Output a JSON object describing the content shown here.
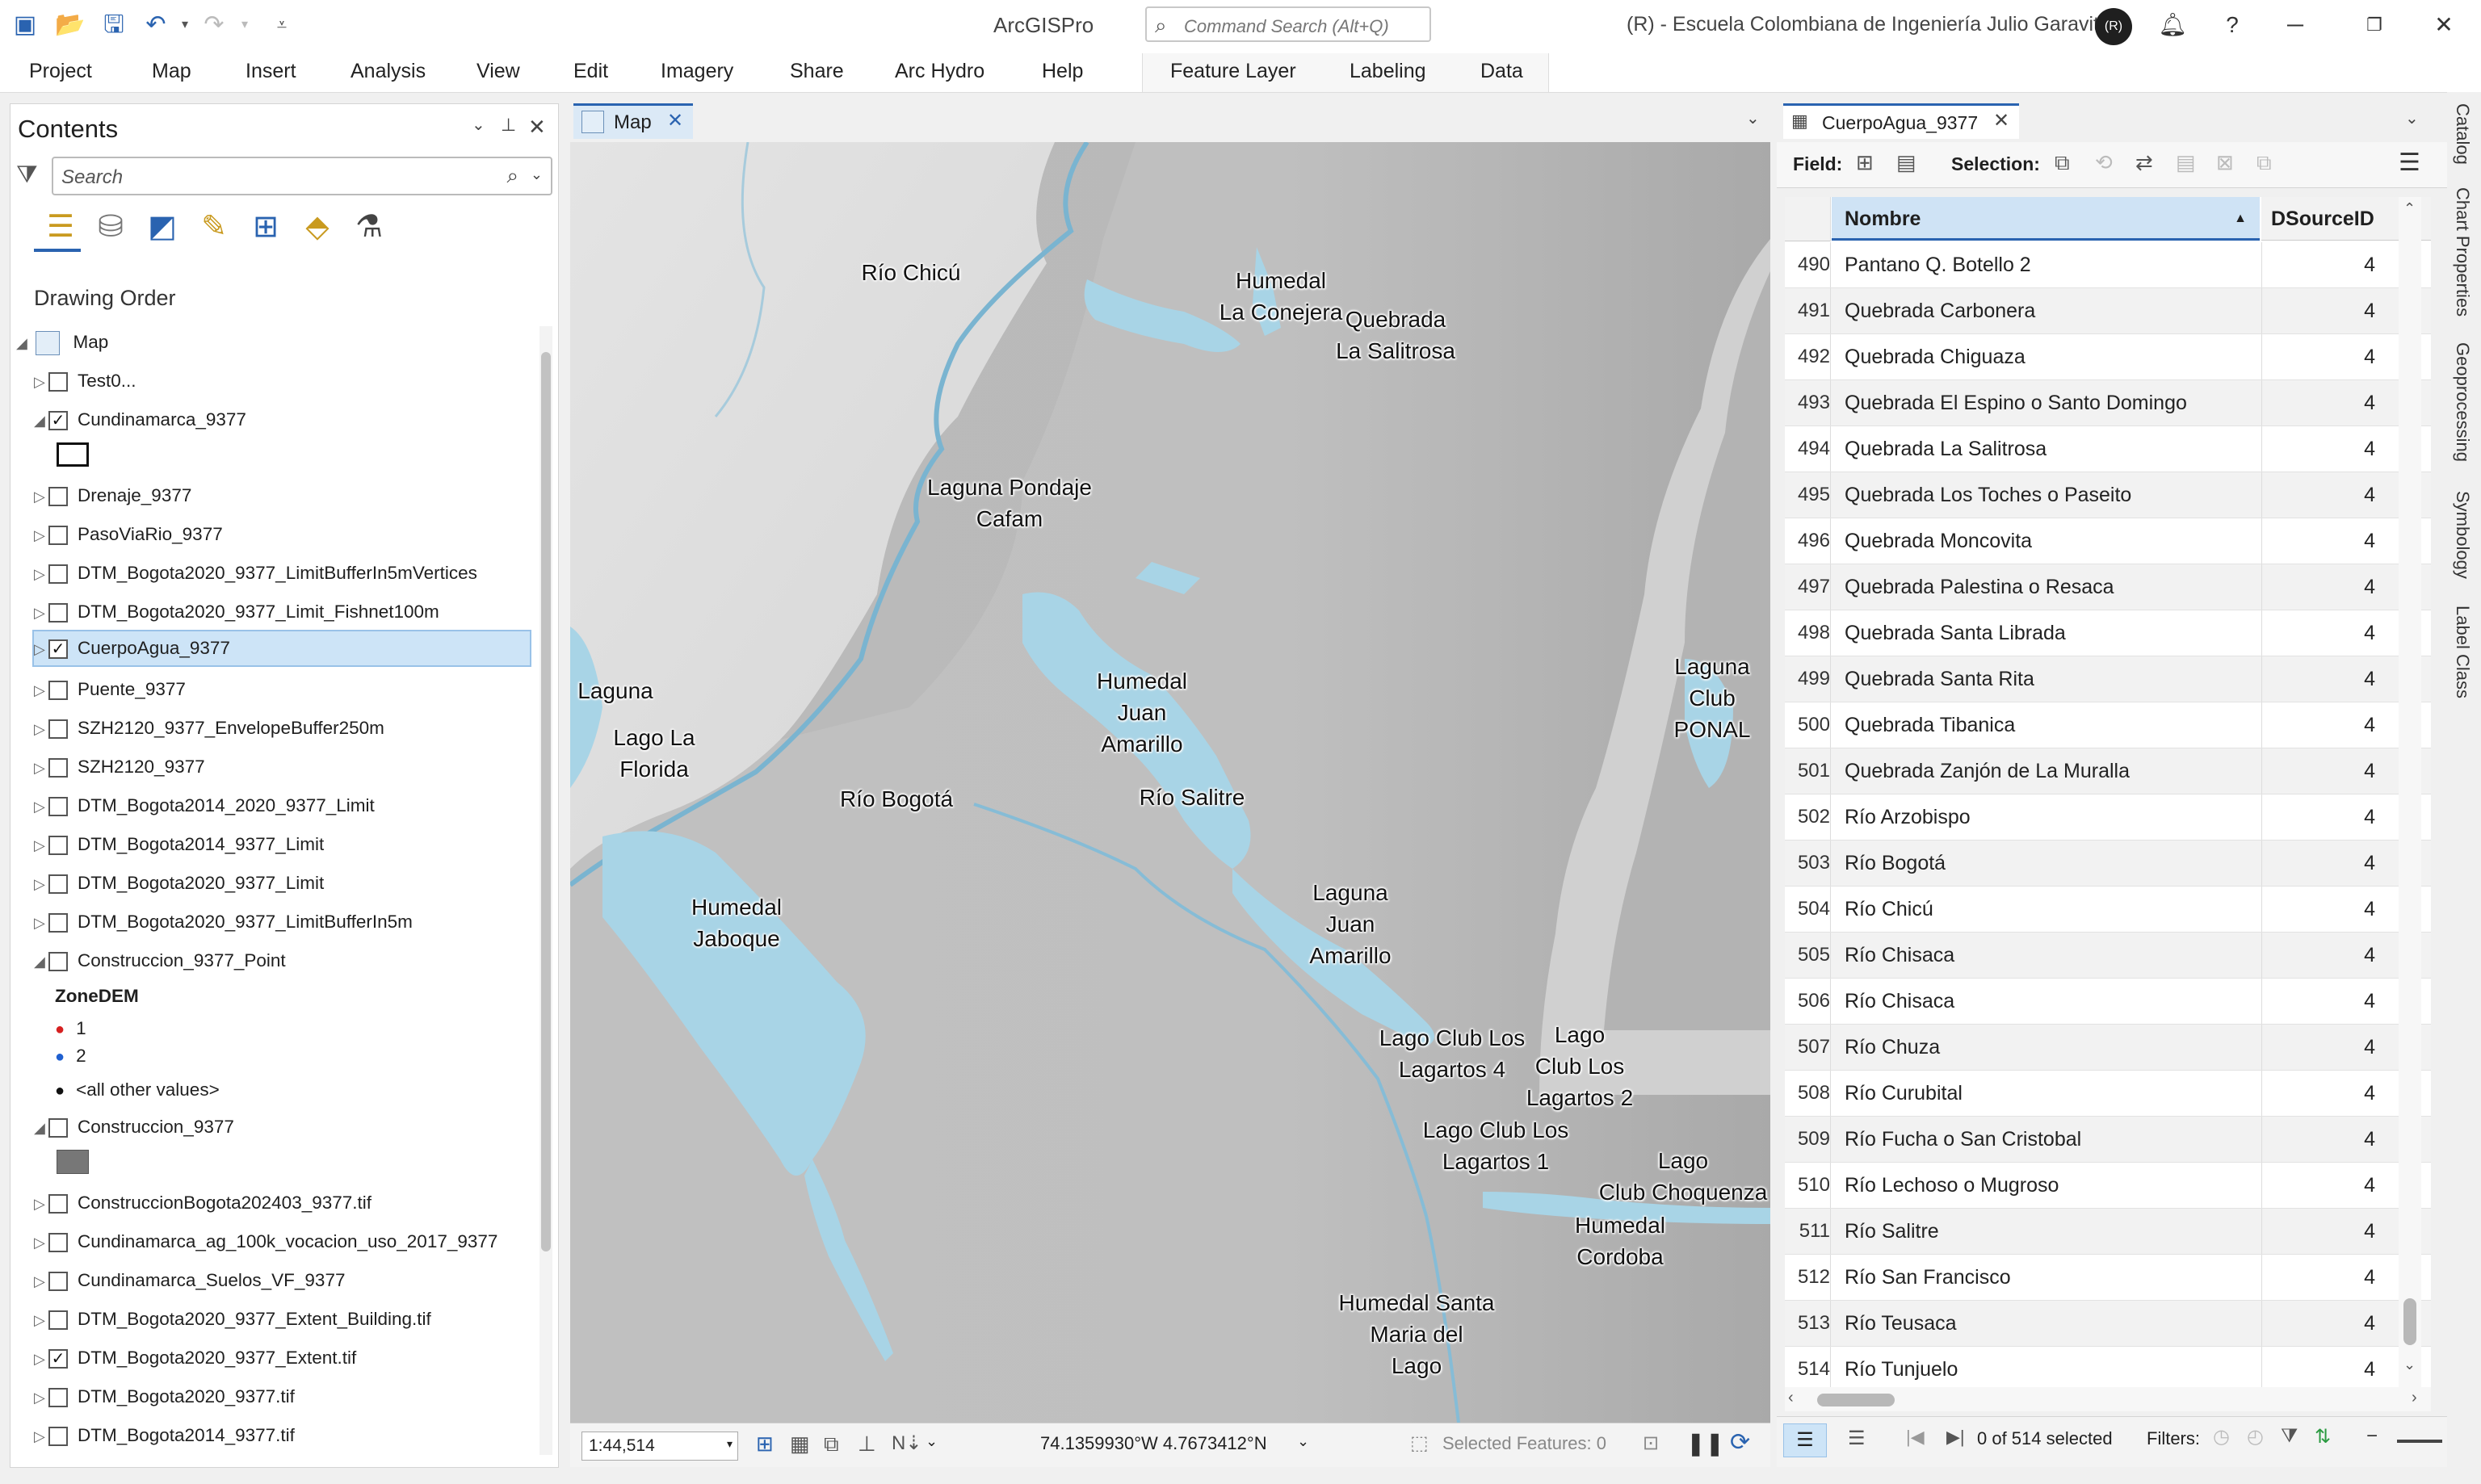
{
  "app": {
    "title": "ArcGISPro",
    "command_search_placeholder": "Command Search (Alt+Q)",
    "user_label": "(R) - Escuela Colombiana de Ingeniería Julio Garavito",
    "user_initials": "(R)"
  },
  "ribbon": {
    "tabs": [
      "Project",
      "Map",
      "Insert",
      "Analysis",
      "View",
      "Edit",
      "Imagery",
      "Share",
      "Arc Hydro",
      "Help"
    ],
    "contextual_tabs": [
      "Feature Layer",
      "Labeling",
      "Data"
    ]
  },
  "contents": {
    "title": "Contents",
    "search_placeholder": "Search",
    "section_title": "Drawing Order",
    "root": "Map",
    "layers": [
      {
        "label": "Test0...",
        "checked": false
      },
      {
        "label": "Cundinamarca_9377",
        "checked": true
      },
      {
        "label": "Drenaje_9377",
        "checked": false
      },
      {
        "label": "PasoViaRio_9377",
        "checked": false
      },
      {
        "label": "DTM_Bogota2020_9377_LimitBufferIn5mVertices",
        "checked": false
      },
      {
        "label": "DTM_Bogota2020_9377_Limit_Fishnet100m",
        "checked": false
      },
      {
        "label": "CuerpoAgua_9377",
        "checked": true,
        "selected": true
      },
      {
        "label": "Puente_9377",
        "checked": false
      },
      {
        "label": "SZH2120_9377_EnvelopeBuffer250m",
        "checked": false
      },
      {
        "label": "SZH2120_9377",
        "checked": false
      },
      {
        "label": "DTM_Bogota2014_2020_9377_Limit",
        "checked": false
      },
      {
        "label": "DTM_Bogota2014_9377_Limit",
        "checked": false
      },
      {
        "label": "DTM_Bogota2020_9377_Limit",
        "checked": false
      },
      {
        "label": "DTM_Bogota2020_9377_LimitBufferIn5m",
        "checked": false
      },
      {
        "label": "Construccion_9377_Point",
        "checked": false
      },
      {
        "label": "Construccion_9377",
        "checked": false
      },
      {
        "label": "ConstruccionBogota202403_9377.tif",
        "checked": false
      },
      {
        "label": "Cundinamarca_ag_100k_vocacion_uso_2017_9377",
        "checked": false
      },
      {
        "label": "Cundinamarca_Suelos_VF_9377",
        "checked": false
      },
      {
        "label": "DTM_Bogota2020_9377_Extent_Building.tif",
        "checked": false
      },
      {
        "label": "DTM_Bogota2020_9377_Extent.tif",
        "checked": true
      },
      {
        "label": "DTM_Bogota2020_9377.tif",
        "checked": false
      },
      {
        "label": "DTM_Bogota2014_9377.tif",
        "checked": false
      }
    ],
    "legend": {
      "field": "ZoneDEM",
      "classes": [
        "1",
        "2",
        "<all other values>"
      ],
      "colors": [
        "#d62020",
        "#2060d0",
        "#111111"
      ]
    }
  },
  "map": {
    "tab_label": "Map",
    "scale": "1:44,514",
    "coordinates": "74.1359930°W 4.7673412°N",
    "selected_features": "Selected Features: 0",
    "water_color": "#a8d4e6",
    "labels": [
      "Río Chicú",
      "Humedal\nLa Conejera",
      "Quebrada\nLa Salitrosa",
      "Laguna Pondaje\nCafam",
      "Laguna",
      "Lago La\nFlorida",
      "Humedal\nJuan\nAmarillo",
      "Laguna\nClub\nPONAL",
      "Río Bogotá",
      "Río Salitre",
      "Humedal\nJaboque",
      "Laguna\nJuan\nAmarillo",
      "Lago Club Los\nLagartos 4",
      "Lago\nClub Los\nLagartos 2",
      "Lago Club Los\nLagartos 1",
      "Lago\nClub Choquenza",
      "Humedal\nCordoba",
      "Humedal Santa\nMaria del\nLago"
    ]
  },
  "table": {
    "tab_label": "CuerpoAgua_9377",
    "toolbar": {
      "field_label": "Field:",
      "selection_label": "Selection:"
    },
    "columns": [
      "Nombre",
      "DSourceID"
    ],
    "rows": [
      {
        "id": "490",
        "name": "Pantano Q. Botello 2",
        "dsid": "4"
      },
      {
        "id": "491",
        "name": "Quebrada Carbonera",
        "dsid": "4"
      },
      {
        "id": "492",
        "name": "Quebrada Chiguaza",
        "dsid": "4"
      },
      {
        "id": "493",
        "name": "Quebrada El Espino o Santo Domingo",
        "dsid": "4"
      },
      {
        "id": "494",
        "name": "Quebrada La Salitrosa",
        "dsid": "4"
      },
      {
        "id": "495",
        "name": "Quebrada Los Toches o Paseito",
        "dsid": "4"
      },
      {
        "id": "496",
        "name": "Quebrada Moncovita",
        "dsid": "4"
      },
      {
        "id": "497",
        "name": "Quebrada Palestina o Resaca",
        "dsid": "4"
      },
      {
        "id": "498",
        "name": "Quebrada Santa Librada",
        "dsid": "4"
      },
      {
        "id": "499",
        "name": "Quebrada Santa Rita",
        "dsid": "4"
      },
      {
        "id": "500",
        "name": "Quebrada Tibanica",
        "dsid": "4"
      },
      {
        "id": "501",
        "name": "Quebrada Zanjón de La Muralla",
        "dsid": "4"
      },
      {
        "id": "502",
        "name": "Río Arzobispo",
        "dsid": "4"
      },
      {
        "id": "503",
        "name": "Río Bogotá",
        "dsid": "4"
      },
      {
        "id": "504",
        "name": "Río Chicú",
        "dsid": "4"
      },
      {
        "id": "505",
        "name": "Río Chisaca",
        "dsid": "4"
      },
      {
        "id": "506",
        "name": "Río Chisaca",
        "dsid": "4"
      },
      {
        "id": "507",
        "name": "Río Chuza",
        "dsid": "4"
      },
      {
        "id": "508",
        "name": "Río Curubital",
        "dsid": "4"
      },
      {
        "id": "509",
        "name": "Río Fucha o San Cristobal",
        "dsid": "4"
      },
      {
        "id": "510",
        "name": "Río Lechoso o Mugroso",
        "dsid": "4"
      },
      {
        "id": "511",
        "name": "Río Salitre",
        "dsid": "4"
      },
      {
        "id": "512",
        "name": "Río San Francisco",
        "dsid": "4"
      },
      {
        "id": "513",
        "name": "Río Teusaca",
        "dsid": "4"
      },
      {
        "id": "514",
        "name": "Río Tunjuelo",
        "dsid": "4"
      }
    ],
    "status_selected": "0 of 514 selected",
    "filters_label": "Filters:"
  },
  "dock_tabs": [
    "Catalog",
    "Chart Properties",
    "Geoprocessing",
    "Symbology",
    "Label Class"
  ]
}
